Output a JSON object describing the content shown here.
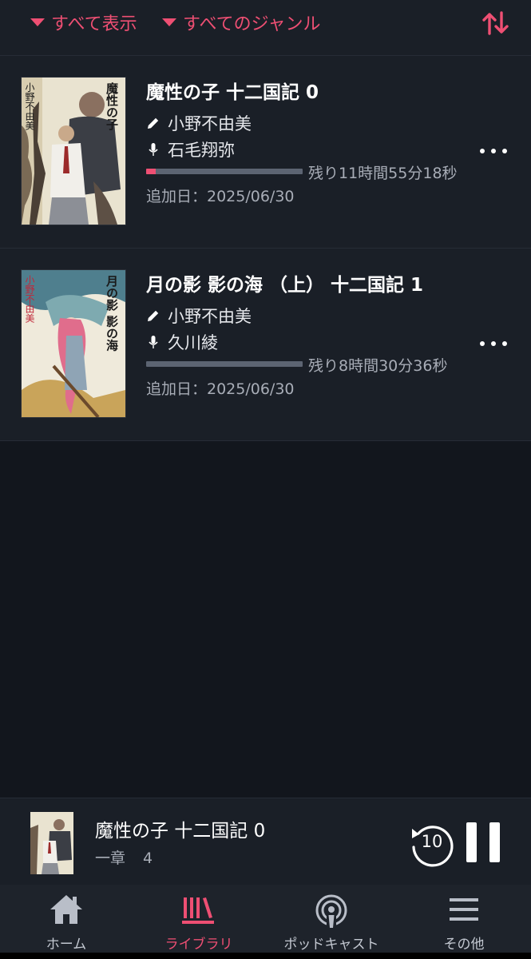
{
  "filters": {
    "show_label": "すべて表示",
    "genre_label": "すべてのジャンル",
    "sort_icon": "sort-arrows-icon",
    "accent_color": "#ee4f73"
  },
  "books": [
    {
      "title": "魔性の子 十二国記 0",
      "author": "小野不由美",
      "narrator": "石毛翔弥",
      "progress": 0.06,
      "remaining": "残り11時間55分18秒",
      "added": "追加日：2025/06/30",
      "cover_title": "魔性の子",
      "cover_author": "小野不由美"
    },
    {
      "title": "月の影 影の海 （上） 十二国記 1",
      "author": "小野不由美",
      "narrator": "久川綾",
      "progress": 0.0,
      "remaining": "残り8時間30分36秒",
      "added": "追加日：2025/06/30",
      "cover_title": "月の影 影の海",
      "cover_author": "小野不由美"
    }
  ],
  "player": {
    "title": "魔性の子 十二国記 0",
    "chapter": "一章",
    "chapter_num": "4",
    "replay_seconds": "10"
  },
  "nav": {
    "items": [
      {
        "label": "ホーム",
        "icon": "home-icon"
      },
      {
        "label": "ライブラリ",
        "icon": "library-icon"
      },
      {
        "label": "ポッドキャスト",
        "icon": "podcast-icon"
      },
      {
        "label": "その他",
        "icon": "menu-icon"
      }
    ],
    "active": "ライブラリ"
  }
}
